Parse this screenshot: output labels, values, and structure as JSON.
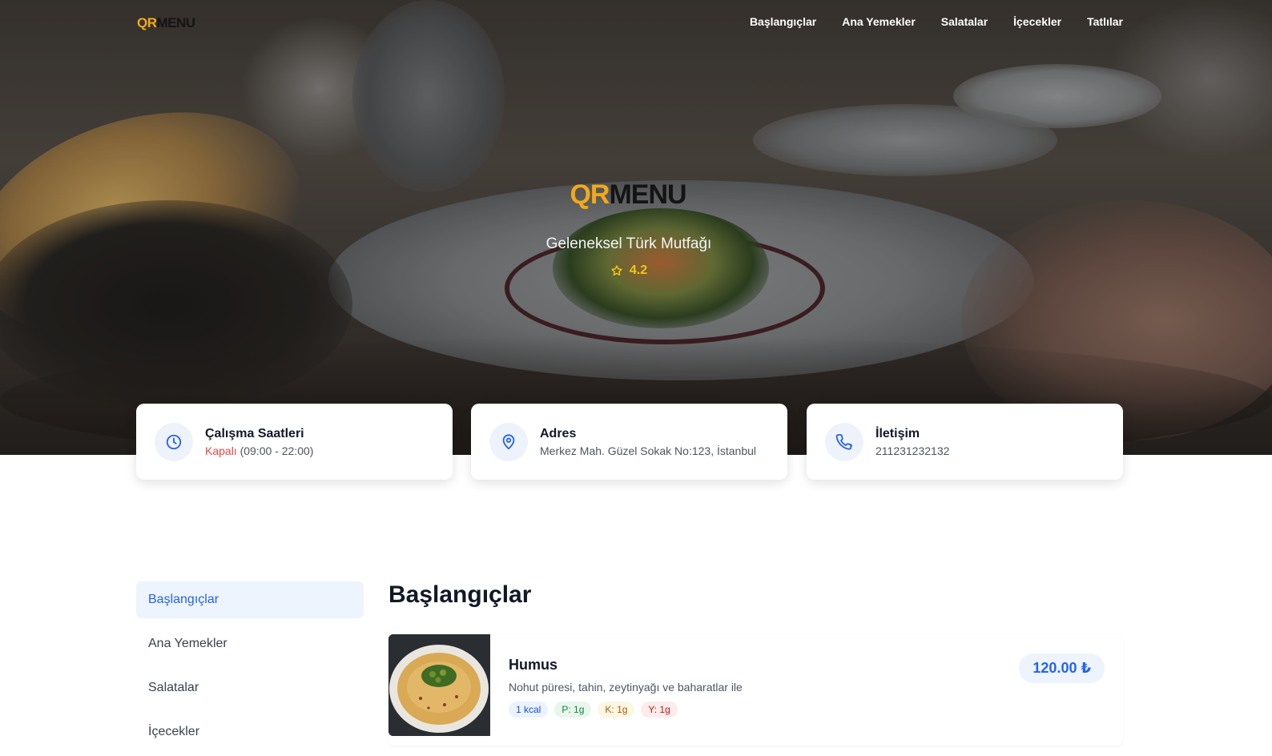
{
  "brand": {
    "qr": "QR",
    "menu": "MENU"
  },
  "nav": {
    "items": [
      "Başlangıçlar",
      "Ana Yemekler",
      "Salatalar",
      "İçecekler",
      "Tatlılar"
    ]
  },
  "hero": {
    "subtitle": "Geleneksel Türk Mutfağı",
    "rating": "4.2"
  },
  "info_cards": {
    "hours": {
      "title": "Çalışma Saatleri",
      "status": "Kapalı",
      "hours": "(09:00 - 22:00)"
    },
    "address": {
      "title": "Adres",
      "value": "Merkez Mah. Güzel Sokak No:123, İstanbul"
    },
    "contact": {
      "title": "İletişim",
      "value": "211231232132"
    }
  },
  "sidebar": {
    "items": [
      "Başlangıçlar",
      "Ana Yemekler",
      "Salatalar",
      "İçecekler"
    ],
    "active": "Başlangıçlar"
  },
  "section": {
    "title": "Başlangıçlar"
  },
  "dishes": [
    {
      "name": "Humus",
      "description": "Nohut püresi, tahin, zeytinyağı ve baharatlar ile",
      "kcal": "1 kcal",
      "protein": "P: 1g",
      "carb": "K: 1g",
      "fat": "Y: 1g",
      "price": "120.00 ₺"
    }
  ],
  "colors": {
    "accent": "#2563eb",
    "brand_yellow": "#f2a91a",
    "closed": "#ef4444",
    "rating": "#f5c518"
  }
}
